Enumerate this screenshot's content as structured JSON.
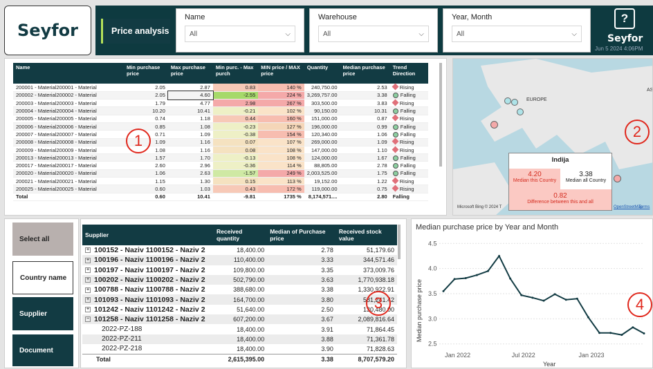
{
  "brand": "Seyfor",
  "page_tab": "Price analysis",
  "slicers": [
    {
      "label": "Name",
      "value": "All"
    },
    {
      "label": "Warehouse",
      "value": "All"
    },
    {
      "label": "Year, Month",
      "value": "All"
    }
  ],
  "help_icon": "question-circle-icon",
  "date_stamp": "Jun 5 2024 4:06PM",
  "badges": [
    "1",
    "2",
    "3",
    "4"
  ],
  "table1": {
    "headers": [
      "Name",
      "Min purchase price",
      "Max purchase price",
      "Min purc. - Max purch",
      "MIN price / MAX price",
      "Quantity",
      "Median purchase price",
      "Trend Direction"
    ],
    "rows": [
      [
        "200001 - Material200001 - Material",
        "2.05",
        "2.87",
        "0.83",
        "140 %",
        "240,750.00",
        "2.53",
        "Rising"
      ],
      [
        "200002 - Material200002 - Material",
        "2.05",
        "4.60",
        "-2.55",
        "224 %",
        "3,269,757.00",
        "3.38",
        "Falling"
      ],
      [
        "200003 - Material200003 - Material",
        "1.79",
        "4.77",
        "2.98",
        "267 %",
        "303,500.00",
        "3.83",
        "Rising"
      ],
      [
        "200004 - Material200004 - Material",
        "10.20",
        "10.41",
        "-0.21",
        "102 %",
        "90,150.00",
        "10.31",
        "Falling"
      ],
      [
        "200005 - Material200005 - Material",
        "0.74",
        "1.18",
        "0.44",
        "160 %",
        "151,000.00",
        "0.87",
        "Rising"
      ],
      [
        "200006 - Material200006 - Material",
        "0.85",
        "1.08",
        "-0.23",
        "127 %",
        "196,000.00",
        "0.99",
        "Falling"
      ],
      [
        "200007 - Material200007 - Material",
        "0.71",
        "1.09",
        "-0.38",
        "154 %",
        "120,340.00",
        "1.06",
        "Falling"
      ],
      [
        "200008 - Material200008 - Material",
        "1.09",
        "1.16",
        "0.07",
        "107 %",
        "269,000.00",
        "1.09",
        "Rising"
      ],
      [
        "200009 - Material200009 - Material",
        "1.08",
        "1.16",
        "0.08",
        "108 %",
        "147,000.00",
        "1.10",
        "Rising"
      ],
      [
        "200013 - Material200013 - Material",
        "1.57",
        "1.70",
        "-0.13",
        "108 %",
        "124,000.00",
        "1.67",
        "Falling"
      ],
      [
        "200017 - Material200017 - Material",
        "2.60",
        "2.96",
        "-0.36",
        "114 %",
        "88,805.00",
        "2.78",
        "Falling"
      ],
      [
        "200020 - Material200020 - Material",
        "1.06",
        "2.63",
        "-1.57",
        "249 %",
        "2,003,525.00",
        "1.75",
        "Falling"
      ],
      [
        "200021 - Material200021 - Material",
        "1.15",
        "1.30",
        "0.15",
        "113 %",
        "19,152.00",
        "1.22",
        "Rising"
      ],
      [
        "200025 - Material200025 - Material",
        "0.60",
        "1.03",
        "0.43",
        "172 %",
        "119,000.00",
        "0.75",
        "Rising"
      ]
    ],
    "total": [
      "Total",
      "0.60",
      "10.41",
      "-9.81",
      "1735 %",
      "8,174,571....",
      "2.80",
      "Falling"
    ]
  },
  "map": {
    "label": "EUROPE",
    "label2": "AS",
    "tooltip": {
      "title": "Indija",
      "median_country": "4.20",
      "median_country_label": "Median this Country",
      "median_all": "3.38",
      "median_all_label": "Median all Country",
      "difference": "0.82",
      "difference_label": "Difference between this and all"
    },
    "credits": "Microsoft Bing © 2024 T",
    "links": [
      "OpenStreetMap",
      "Terms"
    ]
  },
  "side_buttons": [
    "Select all",
    "Country name",
    "Supplier",
    "Document"
  ],
  "table2": {
    "headers": [
      "Supplier",
      "Received quantity",
      "Median of Purchase price",
      "Received stock value"
    ],
    "rows": [
      {
        "t": "+",
        "name": "100152 - Naziv 1100152 - Naziv 2",
        "q": "18,400.00",
        "m": "2.78",
        "v": "51,179.60"
      },
      {
        "t": "+",
        "name": "100196 - Naziv 1100196 - Naziv 2",
        "q": "110,400.00",
        "m": "3.33",
        "v": "344,571.46"
      },
      {
        "t": "+",
        "name": "100197 - Naziv 1100197 - Naziv 2",
        "q": "109,800.00",
        "m": "3.35",
        "v": "373,009.76"
      },
      {
        "t": "+",
        "name": "100202 - Naziv 1100202 - Naziv 2",
        "q": "502,790.00",
        "m": "3.63",
        "v": "1,770,938.18"
      },
      {
        "t": "+",
        "name": "100788 - Naziv 1100788 - Naziv 2",
        "q": "388,680.00",
        "m": "3.38",
        "v": "1,330,922.91"
      },
      {
        "t": "+",
        "name": "101093 - Naziv 1101093 - Naziv 2",
        "q": "164,700.00",
        "m": "3.80",
        "v": "581,241.42"
      },
      {
        "t": "+",
        "name": "101242 - Naziv 1101242 - Naziv 2",
        "q": "51,640.00",
        "m": "2.50",
        "v": "130,480.00"
      },
      {
        "t": "-",
        "name": "101258 - Naziv 1101258 - Naziv 2",
        "q": "607,200.00",
        "m": "3.67",
        "v": "2,089,816.64"
      },
      {
        "t": "",
        "name": "2022-PZ-188",
        "q": "18,400.00",
        "m": "3.91",
        "v": "71,864.45"
      },
      {
        "t": "",
        "name": "2022-PZ-211",
        "q": "18,400.00",
        "m": "3.88",
        "v": "71,361.78"
      },
      {
        "t": "",
        "name": "2022-PZ-218",
        "q": "18,400.00",
        "m": "3.90",
        "v": "71,828.63"
      }
    ],
    "total": {
      "name": "Total",
      "q": "2,615,395.00",
      "m": "3.38",
      "v": "8,707,579.20"
    }
  },
  "chart_data": {
    "type": "line",
    "title": "Median purchase price by Year and Month",
    "xlabel": "Year",
    "ylabel": "Median purchase price",
    "x_ticks": [
      "Jan 2022",
      "Jul 2022",
      "Jan 2023"
    ],
    "y_ticks": [
      "2.5",
      "3.0",
      "3.5",
      "4.0",
      "4.5"
    ],
    "ylim": [
      2.4,
      4.6
    ],
    "x": [
      "2021-12",
      "2022-01",
      "2022-02",
      "2022-03",
      "2022-04",
      "2022-05",
      "2022-06",
      "2022-07",
      "2022-08",
      "2022-09",
      "2022-10",
      "2022-11",
      "2022-12",
      "2023-01",
      "2023-02",
      "2023-03",
      "2023-04",
      "2023-05",
      "2023-06"
    ],
    "values": [
      3.55,
      3.79,
      3.81,
      3.87,
      3.95,
      4.25,
      3.8,
      3.47,
      3.42,
      3.36,
      3.49,
      3.38,
      3.4,
      3.03,
      2.72,
      2.72,
      2.68,
      2.83,
      2.71
    ]
  }
}
